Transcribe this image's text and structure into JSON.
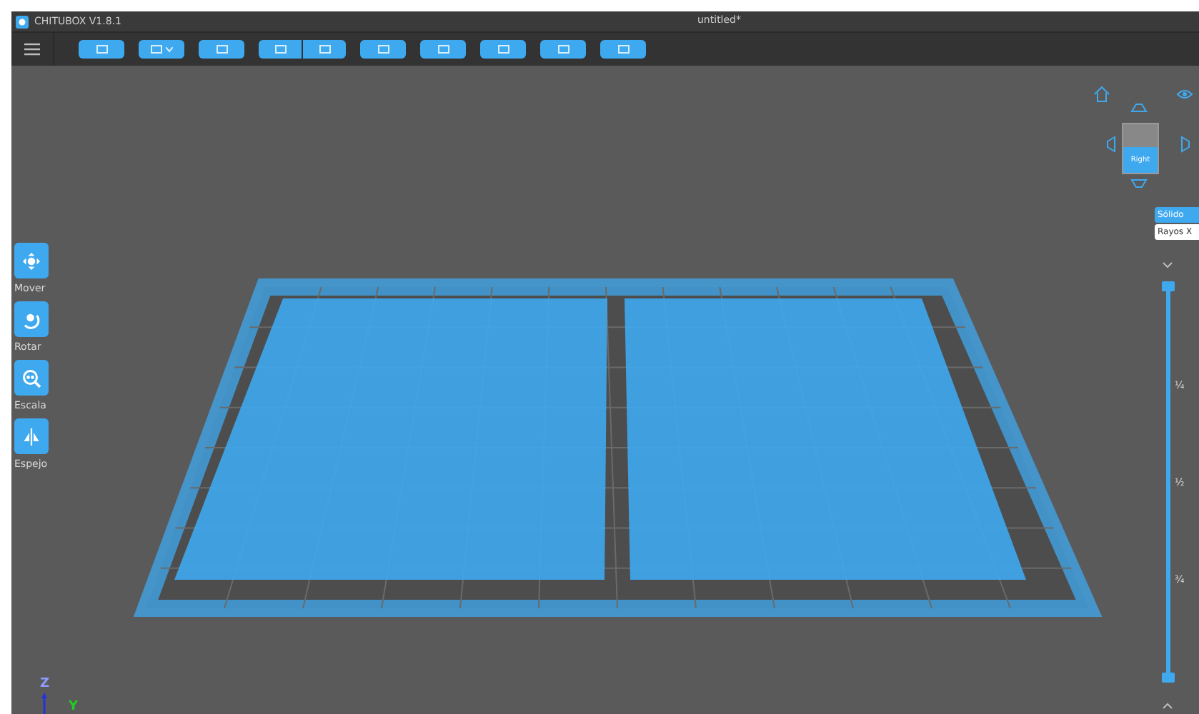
{
  "window": {
    "app_title": "CHITUBOX V1.8.1",
    "document_title": "untitled*"
  },
  "tools": [
    {
      "kind": "move",
      "label": "Mover"
    },
    {
      "kind": "rotate",
      "label": "Rotar"
    },
    {
      "kind": "scale",
      "label": "Escala"
    },
    {
      "kind": "mirror",
      "label": "Espejo"
    }
  ],
  "view_cube": {
    "face": "Right"
  },
  "render_modes": [
    {
      "label": "Sólido",
      "selected": true
    },
    {
      "label": "Rayos X",
      "selected": false
    }
  ],
  "layer_slider": {
    "level": 1,
    "ticks": [
      "¼",
      "½",
      "¾"
    ]
  },
  "axes": [
    {
      "kind": "z",
      "label": "Z"
    },
    {
      "kind": "y",
      "label": "Y"
    }
  ]
}
